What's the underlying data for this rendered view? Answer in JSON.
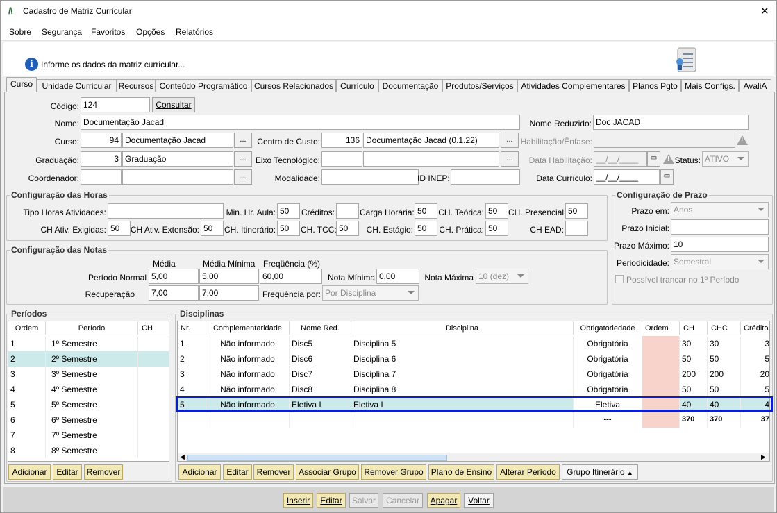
{
  "window": {
    "title": "Cadastro de Matriz Curricular",
    "close": "✕"
  },
  "menu": [
    "Sobre",
    "Segurança",
    "Favoritos",
    "Opções",
    "Relatórios"
  ],
  "info": {
    "message": "Informe os dados da matriz curricular..."
  },
  "tabs": [
    "Curso",
    "Unidade Curricular",
    "Recursos",
    "Conteúdo Programático",
    "Cursos Relacionados",
    "Currículo",
    "Documentação",
    "Produtos/Serviços",
    "Atividades Complementares",
    "Planos Pgto",
    "Mais Configs.",
    "AvaliA"
  ],
  "form": {
    "codigo_label": "Código:",
    "codigo": "124",
    "consultar": "Consultar",
    "nome_label": "Nome:",
    "nome": "Documentação Jacad",
    "nome_reduzido_label": "Nome Reduzido:",
    "nome_reduzido": "Doc JACAD",
    "curso_label": "Curso:",
    "curso_cod": "94",
    "curso_nome": "Documentação Jacad",
    "centro_label": "Centro de Custo:",
    "centro_cod": "136",
    "centro_nome": "Documentação Jacad (0.1.22)",
    "habilitacao_label": "Habilitação/Ênfase:",
    "graduacao_label": "Graduação:",
    "graduacao_cod": "3",
    "graduacao_nome": "Graduação",
    "eixo_label": "Eixo Tecnológico:",
    "data_hab_label": "Data Habilitação:",
    "data_hab": "__/__/____",
    "status_label": "Status:",
    "status": "ATIVO",
    "coordenador_label": "Coordenador:",
    "modalidade_label": "Modalidade:",
    "inep_label": "ID INEP:",
    "data_curr_label": "Data Currículo:",
    "data_curr": "__/__/____",
    "dots": "..."
  },
  "horas": {
    "title": "Configuração das Horas",
    "tipo_label": "Tipo Horas Atividades:",
    "min_label": "Min. Hr. Aula:",
    "min": "50",
    "creditos_label": "Créditos:",
    "carga_label": "Carga Horária:",
    "carga": "50",
    "teorica_label": "CH. Teórica:",
    "teorica": "50",
    "presencial_label": "CH. Presencial:",
    "presencial": "50",
    "exigidas_label": "CH Ativ. Exigidas:",
    "exigidas": "50",
    "extensao_label": "CH Ativ. Extensão:",
    "extensao": "50",
    "itinerario_label": "CH. Itinerário:",
    "itinerario": "50",
    "tcc_label": "CH. TCC:",
    "tcc": "50",
    "estagio_label": "CH. Estágio:",
    "estagio": "50",
    "pratica_label": "CH. Prática:",
    "pratica": "50",
    "ead_label": "CH EAD:"
  },
  "prazo": {
    "title": "Configuração de Prazo",
    "prazo_em_label": "Prazo em:",
    "prazo_em": "Anos",
    "inicial_label": "Prazo Inicial:",
    "maximo_label": "Prazo Máximo:",
    "maximo": "10",
    "period_label": "Periodicidade:",
    "period": "Semestral",
    "trancar": "Possível trancar no 1º Período"
  },
  "notas": {
    "title": "Configuração das Notas",
    "media_h": "Média",
    "media_min_h": "Média Mínima",
    "freq_h": "Freqüência (%)",
    "periodo_label": "Período Normal",
    "pn_media": "5,00",
    "pn_min": "5,00",
    "pn_freq": "60,00",
    "nota_min_label": "Nota Mínima",
    "nota_min": "0,00",
    "nota_max_label": "Nota Máxima",
    "nota_max": "10 (dez)",
    "recup_label": "Recuperação",
    "rc_media": "7,00",
    "rc_min": "7,00",
    "freq_por_label": "Frequência por:",
    "freq_por": "Por Disciplina"
  },
  "periodos": {
    "title": "Períodos",
    "headers": [
      "Ordem",
      "Período",
      "CH"
    ],
    "rows": [
      [
        "1",
        "1º Semestre",
        ""
      ],
      [
        "2",
        "2º Semestre",
        ""
      ],
      [
        "3",
        "3º Semestre",
        ""
      ],
      [
        "4",
        "4º Semestre",
        ""
      ],
      [
        "5",
        "5º Semestre",
        ""
      ],
      [
        "6",
        "6º Semestre",
        ""
      ],
      [
        "7",
        "7º Semestre",
        ""
      ],
      [
        "8",
        "8º Semestre",
        ""
      ]
    ],
    "buttons": [
      "Adicionar",
      "Editar",
      "Remover"
    ]
  },
  "disciplinas": {
    "title": "Disciplinas",
    "headers": [
      "Nr.",
      "Complementaridade",
      "Nome Red.",
      "Disciplina",
      "Obrigatoriedade",
      "Ordem",
      "CH",
      "CHC",
      "Créditos"
    ],
    "rows": [
      [
        "1",
        "Não informado",
        "Disc5",
        "Disciplina 5",
        "Obrigatória",
        "",
        "30",
        "30",
        "3"
      ],
      [
        "2",
        "Não informado",
        "Disc6",
        "Disciplina 6",
        "Obrigatória",
        "",
        "50",
        "50",
        "5"
      ],
      [
        "3",
        "Não informado",
        "Disc7",
        "Disciplina 7",
        "Obrigatória",
        "",
        "200",
        "200",
        "20"
      ],
      [
        "4",
        "Não informado",
        "Disc8",
        "Disciplina 8",
        "Obrigatória",
        "",
        "50",
        "50",
        "5"
      ],
      [
        "5",
        "Não informado",
        "Eletiva I",
        "Eletiva I",
        "Eletiva",
        "",
        "40",
        "40",
        "4"
      ]
    ],
    "totals": [
      "",
      "",
      "",
      "",
      "---",
      "",
      "370",
      "370",
      "37"
    ],
    "buttons": [
      "Adicionar",
      "Editar",
      "Remover",
      "Associar Grupo",
      "Remover Grupo",
      "Plano de Ensino",
      "Alterar Período",
      "Grupo Itinerário"
    ]
  },
  "footer": [
    "Inserir",
    "Editar",
    "Salvar",
    "Cancelar",
    "Apagar",
    "Voltar"
  ]
}
